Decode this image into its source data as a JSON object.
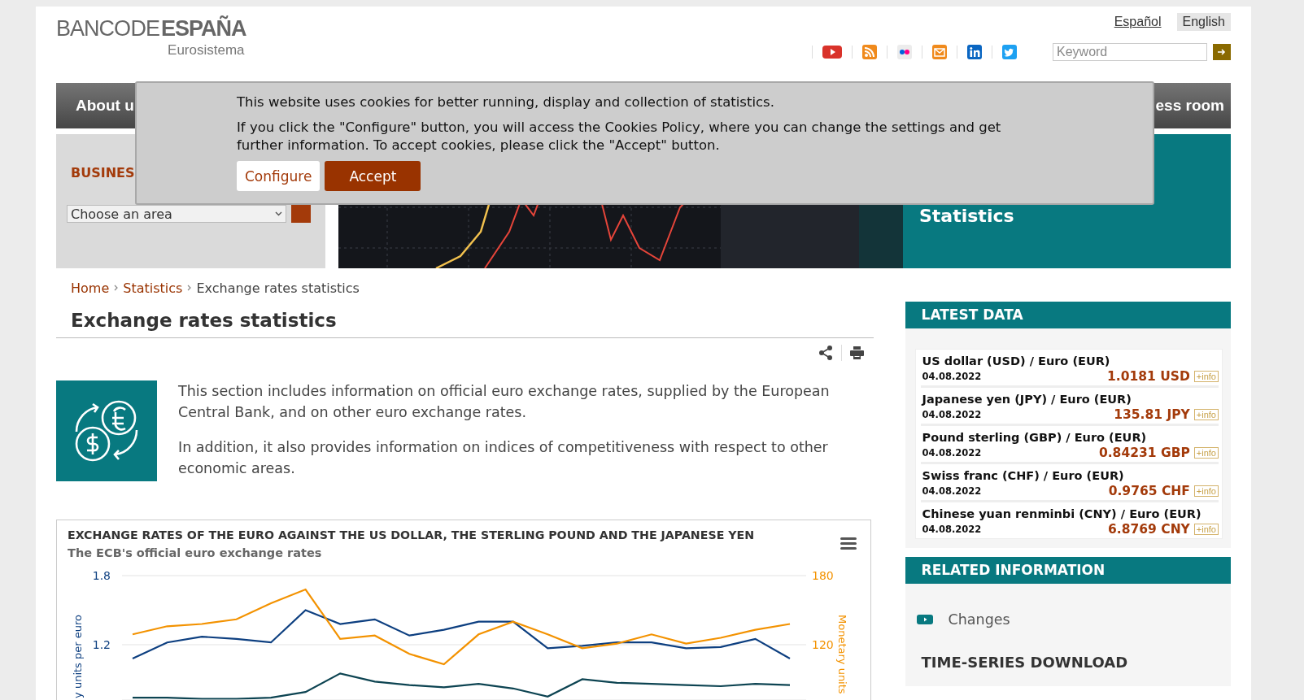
{
  "header": {
    "logo": {
      "light": "BANCO DE",
      "bold": "ESPAÑA",
      "tagline": "Eurosistema"
    },
    "languages": [
      {
        "label": "Español",
        "selected": false
      },
      {
        "label": "English",
        "selected": true
      }
    ],
    "search": {
      "placeholder": "Keyword"
    }
  },
  "nav": {
    "items": [
      {
        "label": "About u"
      },
      {
        "label": "ess room"
      }
    ]
  },
  "cookie_banner": {
    "message": "This website uses cookies for better running, display and collection of statistics.",
    "details": "If you click the \"Configure\" button, you will access the Cookies Policy, where you can change the settings and get further information. To accept cookies, please click the \"Accept\" button.",
    "buttons": [
      {
        "label": "Configure",
        "kind": "secondary"
      },
      {
        "label": "Accept",
        "kind": "primary"
      }
    ]
  },
  "business_panel": {
    "heading": "BUSINES",
    "select": {
      "value": "Choose an area"
    }
  },
  "feature_panel": {
    "title": "Statistics"
  },
  "breadcrumb": [
    {
      "label": "Home",
      "link": true
    },
    {
      "label": "Statistics",
      "link": true
    },
    {
      "label": "Exchange rates statistics",
      "link": false
    }
  ],
  "page_title": "Exchange rates statistics",
  "intro": [
    "This section includes information on official euro exchange rates, supplied by the European Central Bank, and on other euro exchange rates.",
    "In addition, it also provides information on indices of competitiveness with respect to other economic areas."
  ],
  "chart": {
    "title": "EXCHANGE RATES OF THE EURO AGAINST THE US DOLLAR, THE STERLING POUND AND THE JAPANESE YEN",
    "subtitle": "The ECB's official euro exchange rates",
    "chart_data": {
      "type": "line",
      "ylabel": "y units per euro",
      "y2label": "Monetary units",
      "ylim": [
        0.72,
        1.8
      ],
      "y2lim": [
        72,
        180
      ],
      "yticks": [
        1.2,
        1.8
      ],
      "y2ticks": [
        120,
        180
      ],
      "series": [
        {
          "color": "#0d3f80",
          "values": [
            1.08,
            1.22,
            1.27,
            1.25,
            1.22,
            1.5,
            1.38,
            1.42,
            1.28,
            1.33,
            1.4,
            1.4,
            1.17,
            1.19,
            1.22,
            1.22,
            1.17,
            1.18,
            1.25,
            1.08
          ]
        },
        {
          "color": "#f39200",
          "axis": "y2",
          "values": [
            129,
            136,
            138,
            142,
            156,
            168,
            125,
            128,
            112,
            103,
            129,
            140,
            129,
            117,
            121,
            129,
            121,
            126,
            133,
            138
          ]
        },
        {
          "color": "#0d4452",
          "values": [
            0.74,
            0.74,
            0.73,
            0.73,
            0.74,
            0.79,
            0.95,
            0.88,
            0.85,
            0.83,
            0.86,
            0.82,
            0.75,
            0.9,
            0.87,
            0.86,
            0.85,
            0.84,
            0.86,
            0.85
          ]
        }
      ]
    }
  },
  "latest_data": {
    "title": "LATEST DATA",
    "rates": [
      {
        "pair": "US dollar (USD) / Euro (EUR)",
        "date": "04.08.2022",
        "value": "1.0181 USD",
        "more": "+info"
      },
      {
        "pair": "Japanese yen (JPY) / Euro (EUR)",
        "date": "04.08.2022",
        "value": "135.81 JPY",
        "more": "+info"
      },
      {
        "pair": "Pound sterling (GBP) / Euro (EUR)",
        "date": "04.08.2022",
        "value": "0.84231 GBP",
        "more": "+info"
      },
      {
        "pair": "Swiss franc (CHF) / Euro (EUR)",
        "date": "04.08.2022",
        "value": "0.9765 CHF",
        "more": "+info"
      },
      {
        "pair": "Chinese yuan renminbi (CNY) / Euro (EUR)",
        "date": "04.08.2022",
        "value": "6.8769 CNY",
        "more": "+info"
      }
    ]
  },
  "related_information": {
    "title": "RELATED INFORMATION",
    "links": [
      {
        "label": "Changes"
      }
    ]
  },
  "time_series_download": {
    "title": "TIME-SERIES DOWNLOAD"
  }
}
